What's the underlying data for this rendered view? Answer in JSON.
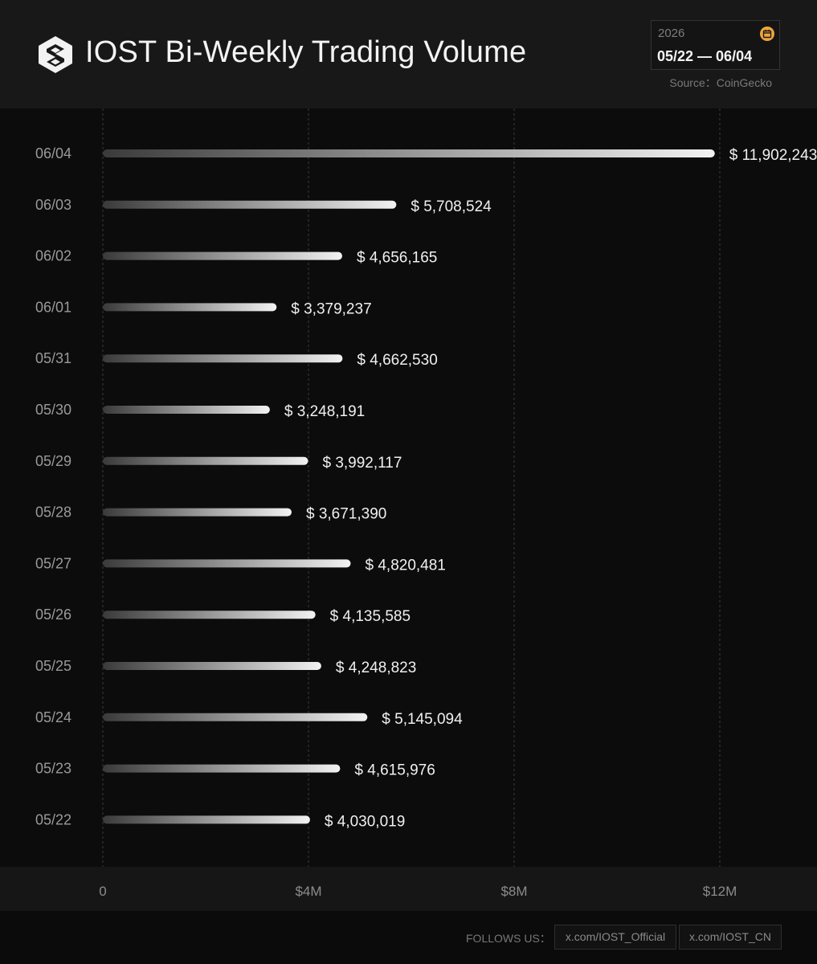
{
  "header": {
    "title": "IOST Bi-Weekly Trading Volume",
    "year": "2026",
    "date_range": "05/22 — 06/04",
    "source": "Source：CoinGecko"
  },
  "footer": {
    "follows_label": "FOLLOWS US：",
    "links": [
      "x.com/IOST_Official",
      "x.com/IOST_CN"
    ]
  },
  "colors": {
    "background": "#0c0c0c",
    "bar_start": "#3a3a3a",
    "bar_end": "#f2f2f2",
    "calendar_accent": "#f0a43c"
  },
  "chart_data": {
    "type": "bar",
    "orientation": "horizontal",
    "categories": [
      "06/04",
      "06/03",
      "06/02",
      "06/01",
      "05/31",
      "05/30",
      "05/29",
      "05/28",
      "05/27",
      "05/26",
      "05/25",
      "05/24",
      "05/23",
      "05/22"
    ],
    "values": [
      11902243,
      5708524,
      4656165,
      3379237,
      4662530,
      3248191,
      3992117,
      3671390,
      4820481,
      4135585,
      4248823,
      5145094,
      4615976,
      4030019
    ],
    "value_labels": [
      "$ 11,902,243",
      "$ 5,708,524",
      "$ 4,656,165",
      "$ 3,379,237",
      "$ 4,662,530",
      "$ 3,248,191",
      "$ 3,992,117",
      "$ 3,671,390",
      "$ 4,820,481",
      "$ 4,135,585",
      "$ 4,248,823",
      "$ 5,145,094",
      "$ 4,615,976",
      "$ 4,030,019"
    ],
    "xlim": [
      0,
      12000000
    ],
    "xticks": [
      0,
      4000000,
      8000000,
      12000000
    ],
    "xtick_labels": [
      "0",
      "$4M",
      "$8M",
      "$12M"
    ],
    "grid": "vertical dashed"
  }
}
